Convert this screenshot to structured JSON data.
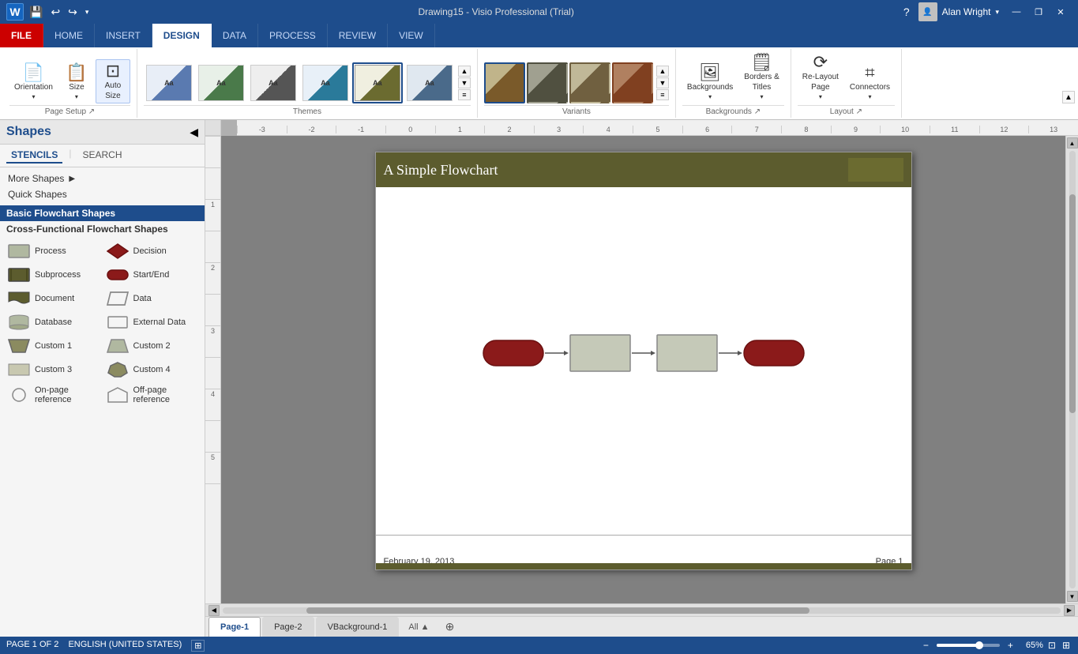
{
  "titleBar": {
    "appIcon": "W",
    "title": "Drawing15 - Visio Professional (Trial)",
    "user": "Alan Wright",
    "helpBtn": "?",
    "minimizeBtn": "—",
    "restoreBtn": "❐",
    "closeBtn": "✕"
  },
  "ribbon": {
    "tabs": [
      "FILE",
      "HOME",
      "INSERT",
      "DESIGN",
      "DATA",
      "PROCESS",
      "REVIEW",
      "VIEW"
    ],
    "activeTab": "DESIGN",
    "groups": {
      "pageSetup": {
        "label": "Page Setup",
        "buttons": [
          "Orientation",
          "Size",
          "Auto Size"
        ]
      },
      "themes": {
        "label": "Themes"
      },
      "variants": {
        "label": "Variants"
      },
      "backgrounds": {
        "label": "Backgrounds",
        "buttons": [
          "Backgrounds",
          "Borders & Titles"
        ]
      },
      "layout": {
        "label": "Layout",
        "buttons": [
          "Re-Layout Page",
          "Connectors"
        ]
      }
    }
  },
  "sidebar": {
    "title": "Shapes",
    "tabs": [
      "STENCILS",
      "SEARCH"
    ],
    "sections": [
      {
        "label": "More Shapes",
        "hasArrow": true
      },
      {
        "label": "Quick Shapes",
        "hasArrow": false
      }
    ],
    "categories": [
      {
        "label": "Basic Flowchart Shapes",
        "active": true
      },
      {
        "label": "Cross-Functional Flowchart Shapes",
        "active": false
      }
    ],
    "shapes": [
      {
        "id": "process",
        "label": "Process",
        "type": "rect"
      },
      {
        "id": "decision",
        "label": "Decision",
        "type": "diamond"
      },
      {
        "id": "subprocess",
        "label": "Subprocess",
        "type": "rect-dark"
      },
      {
        "id": "startend",
        "label": "Start/End",
        "type": "ellipse-dark"
      },
      {
        "id": "document",
        "label": "Document",
        "type": "document"
      },
      {
        "id": "data",
        "label": "Data",
        "type": "parallelogram"
      },
      {
        "id": "database",
        "label": "Database",
        "type": "cylinder"
      },
      {
        "id": "externaldata",
        "label": "External Data",
        "type": "rect-r"
      },
      {
        "id": "custom1",
        "label": "Custom 1",
        "type": "trapezoid"
      },
      {
        "id": "custom2",
        "label": "Custom 2",
        "type": "trapezoid-r"
      },
      {
        "id": "custom3",
        "label": "Custom 3",
        "type": "rect-light"
      },
      {
        "id": "custom4",
        "label": "Custom 4",
        "type": "hexagon"
      },
      {
        "id": "onpage",
        "label": "On-page reference",
        "type": "circle"
      },
      {
        "id": "offpage",
        "label": "Off-page reference",
        "type": "shield"
      }
    ]
  },
  "canvas": {
    "rulerMarks": [
      "-3",
      "-2",
      "-1",
      "0",
      "1",
      "2",
      "3",
      "4",
      "5",
      "6",
      "7",
      "8",
      "9",
      "10",
      "11",
      "12",
      "13"
    ],
    "rulerMarksV": [
      "",
      "",
      "1",
      "",
      "2",
      "",
      "3",
      "",
      "4",
      "",
      "5",
      ""
    ],
    "page": {
      "title": "A Simple Flowchart",
      "date": "February 19, 2013",
      "pageNum": "Page 1"
    }
  },
  "pageTabs": {
    "tabs": [
      "Page-1",
      "Page-2",
      "VBackground-1"
    ],
    "activeTab": "Page-1",
    "allLabel": "All ▲",
    "addLabel": "+"
  },
  "statusBar": {
    "left": [
      "PAGE 1 OF 2",
      "ENGLISH (UNITED STATES)"
    ],
    "zoom": "65%"
  }
}
